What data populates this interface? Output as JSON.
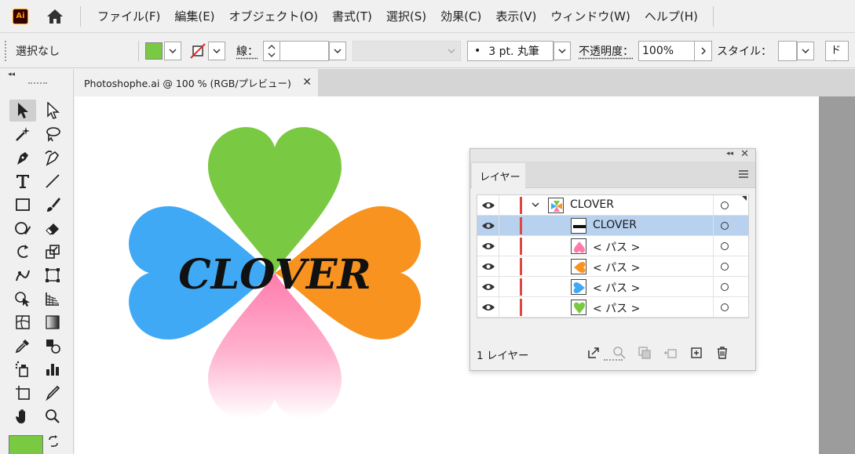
{
  "app": {
    "logo_text": "Ai",
    "menu": [
      "ファイル(F)",
      "編集(E)",
      "オブジェクト(O)",
      "書式(T)",
      "選択(S)",
      "効果(C)",
      "表示(V)",
      "ウィンドウ(W)",
      "ヘルプ(H)"
    ]
  },
  "control_bar": {
    "selection": "選択なし",
    "fill_color": "#7ac943",
    "stroke_label": "線：",
    "brush_bullet": "•",
    "brush": "3 pt. 丸筆",
    "opacity_label": "不透明度：",
    "opacity_value": "100%",
    "style_label": "スタイル：",
    "last_button": "ドキ"
  },
  "document": {
    "tab_title": "Photoshophe.ai @ 100 % (RGB/プレビュー)",
    "close_glyph": "✕",
    "artwork_text": "CLOVER",
    "leaf_colors": {
      "top": "#7ac943",
      "left": "#3fa9f5",
      "right": "#f7931e",
      "bottom": "#ff7bac"
    }
  },
  "layers_panel": {
    "tab": "レイヤー",
    "rows": [
      {
        "name": "CLOVER",
        "level": 0,
        "expanded": true,
        "selected": false,
        "thumb": "clover-thumb"
      },
      {
        "name": "CLOVER",
        "level": 1,
        "selected": true,
        "thumb": "text-thumb"
      },
      {
        "name": "< パス >",
        "level": 1,
        "selected": false,
        "thumb": "pink-heart-thumb"
      },
      {
        "name": "< パス >",
        "level": 1,
        "selected": false,
        "thumb": "orange-heart-thumb"
      },
      {
        "name": "< パス >",
        "level": 1,
        "selected": false,
        "thumb": "blue-heart-thumb"
      },
      {
        "name": "< パス >",
        "level": 1,
        "selected": false,
        "thumb": "green-heart-thumb"
      }
    ],
    "footer_count": "1 レイヤー",
    "accent": "#e0473f"
  }
}
